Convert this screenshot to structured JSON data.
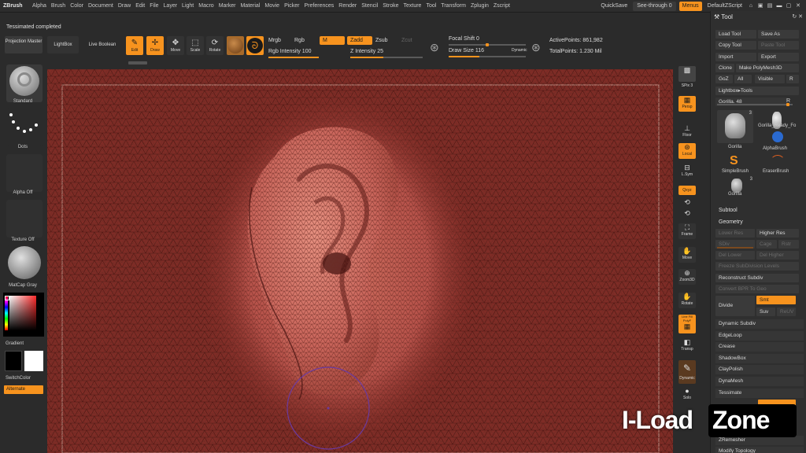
{
  "app": {
    "logo": "ZBrush"
  },
  "menu": [
    "Alpha",
    "Brush",
    "Color",
    "Document",
    "Draw",
    "Edit",
    "File",
    "Layer",
    "Light",
    "Macro",
    "Marker",
    "Material",
    "Movie",
    "Picker",
    "Preferences",
    "Render",
    "Stencil",
    "Stroke",
    "Texture",
    "Tool",
    "Transform",
    "Zplugin",
    "Zscript"
  ],
  "menubar_right": {
    "quicksave": "QuickSave",
    "seethrough": "See-through  0",
    "menus": "Menus",
    "script": "DefaultZScript"
  },
  "status": "Tessimated completed",
  "shelf": {
    "projection_master": "Projection Master",
    "lightbox": "LightBox",
    "live_boolean": "Live Boolean",
    "edit": "Edit",
    "draw": "Draw",
    "move": "Move",
    "scale": "Scale",
    "rotate": "Rotate",
    "mrgb": "Mrgb",
    "rgb": "Rgb",
    "m": "M",
    "zadd": "Zadd",
    "zsub": "Zsub",
    "zcut": "Zcut",
    "rgb_intensity": "Rgb Intensity 100",
    "z_intensity": "Z Intensity 25",
    "focal_shift": "Focal Shift 0",
    "draw_size": "Draw Size 116",
    "dynamic": "Dynamic",
    "active_points": "ActivePoints: 861,982",
    "total_points": "TotalPoints: 1.230 Mil"
  },
  "left_shelf": {
    "brush": "Standard",
    "stroke": "Dots",
    "alpha": "Alpha Off",
    "texture": "Texture Off",
    "material": "MatCap Gray",
    "gradient": "Gradient",
    "switchcolor": "SwitchColor",
    "alternate": "Alternate"
  },
  "right_shelf": {
    "spix": "SPix 3",
    "persp": "Persp",
    "floor": "Floor",
    "local": "Local",
    "lsym": "L.Sym",
    "xyz": "Qxyz",
    "frame": "Frame",
    "move": "Move",
    "zoom3d": "Zoom3D",
    "rotate": "Rotate",
    "linefill": "Line Fill PolyF",
    "transp": "Transp",
    "dynamic": "Dynamic",
    "solo": "Solo"
  },
  "palette": {
    "title": "Tool",
    "load_tool": "Load Tool",
    "save_as": "Save As",
    "copy_tool": "Copy Tool",
    "paste_tool": "Paste Tool",
    "import": "Import",
    "export": "Export",
    "clone": "Clone",
    "make_polymesh": "Make PolyMesh3D",
    "goz": "GoZ",
    "all": "All",
    "visible": "Visible",
    "r": "R",
    "lightbox_tools": "Lightbox▸Tools",
    "current_tool": "Gorilla. 48",
    "tiles": [
      {
        "label": "Gorilla",
        "count": "3"
      },
      {
        "label": "Gorilla_Ready_Fo",
        "count": ""
      },
      {
        "label": "AlphaBrush",
        "count": ""
      },
      {
        "label": "SimpleBrush",
        "count": ""
      },
      {
        "label": "EraserBrush",
        "count": ""
      },
      {
        "label": "Gorilla",
        "count": "3"
      }
    ],
    "subtool": "Subtool",
    "geometry": "Geometry",
    "lower_res": "Lower Res",
    "higher_res": "Higher Res",
    "sdiv": "SDiv",
    "cage": "Cage",
    "rstr": "Rstr",
    "del_lower": "Del Lower",
    "del_higher": "Del Higher",
    "freeze": "Freeze SubDivision Levels",
    "reconstruct": "Reconstruct Subdiv",
    "convert_bpr": "Convert BPR To Geo",
    "divide": "Divide",
    "smt": "Smt",
    "suv": "Suv",
    "reuv": "ReUV",
    "items": [
      "Dynamic Subdiv",
      "EdgeLoop",
      "Crease",
      "ShadowBox",
      "ClayPolish",
      "DynaMesh",
      "Tessimate",
      "",
      "ZRemesher",
      "Modify Topology"
    ]
  },
  "watermark": {
    "left": "I-Load",
    "right": "Zone"
  }
}
